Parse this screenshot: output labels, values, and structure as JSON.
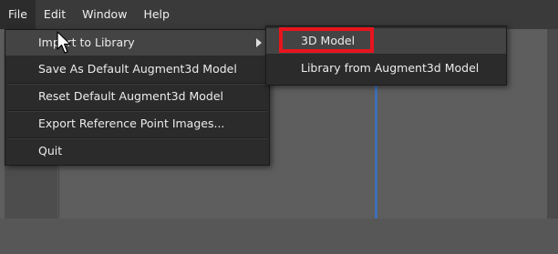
{
  "menubar": {
    "items": [
      "File",
      "Edit",
      "Window",
      "Help"
    ]
  },
  "file_menu": {
    "items": [
      "Import to Library",
      "Save As Default Augment3d Model",
      "Reset Default Augment3d Model",
      "Export Reference Point Images...",
      "Quit"
    ]
  },
  "submenu": {
    "items": [
      "3D Model",
      "Library from Augment3d Model"
    ]
  },
  "colors": {
    "highlight_box": "#e8141c",
    "menu_bg": "#2b2b2b",
    "menubar_bg": "#3a3a3a"
  }
}
